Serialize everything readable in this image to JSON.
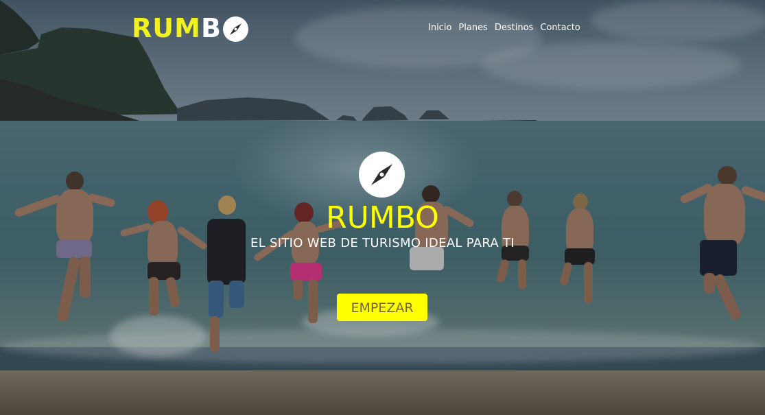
{
  "header": {
    "logo_part_yellow": "RUM",
    "logo_part_white": "B",
    "logo_part_white_end": "O",
    "logo_icon": "compass-icon"
  },
  "nav": {
    "items": [
      {
        "label": "Inicio"
      },
      {
        "label": "Planes"
      },
      {
        "label": "Destinos"
      },
      {
        "label": "Contacto"
      }
    ]
  },
  "hero": {
    "icon": "compass-icon",
    "title": "RUMBO",
    "subtitle": "EL SITIO WEB DE TURISMO IDEAL PARA TI",
    "cta_label": "EMPEZAR"
  },
  "colors": {
    "accent": "#ffff00",
    "logo_yellow": "#f1f11e",
    "text_light": "#ffffff",
    "cta_text": "#6f6a2c"
  }
}
